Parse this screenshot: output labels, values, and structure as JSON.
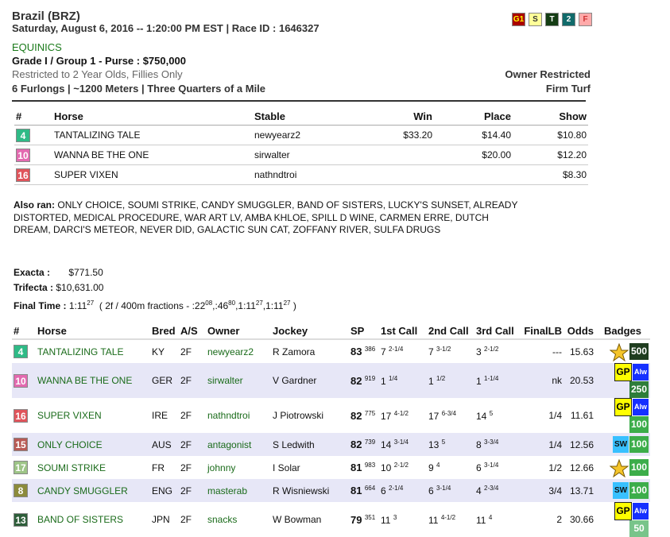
{
  "header": {
    "track": "Brazil (BRZ)",
    "date_line": "Saturday, August 6, 2016 -- 1:20:00 PM EST | Race ID : 1646327",
    "brand": "EQUINICS",
    "grade_purse": "Grade I / Group 1 - Purse : $750,000",
    "restriction": "Restricted to 2 Year Olds, Fillies Only",
    "distance": "6 Furlongs | ~1200 Meters | Three Quarters of a Mile",
    "owner_restricted": "Owner Restricted",
    "surface": "Firm Turf",
    "badges": [
      {
        "label": "G1",
        "cls": "tb-g1"
      },
      {
        "label": "S",
        "cls": "tb-s"
      },
      {
        "label": "T",
        "cls": "tb-t"
      },
      {
        "label": "2",
        "cls": "tb-2"
      },
      {
        "label": "F",
        "cls": "tb-f"
      }
    ]
  },
  "results": {
    "columns": [
      "#",
      "Horse",
      "Stable",
      "Win",
      "Place",
      "Show"
    ],
    "rows": [
      {
        "num": "4",
        "color": "#2fba86",
        "horse": "TANTALIZING TALE",
        "stable": "newyearz2",
        "win": "$33.20",
        "place": "$14.40",
        "show": "$10.80"
      },
      {
        "num": "10",
        "color": "#e36ab0",
        "horse": "WANNA BE THE ONE",
        "stable": "sirwalter",
        "win": "",
        "place": "$20.00",
        "show": "$12.20"
      },
      {
        "num": "16",
        "color": "#e0545b",
        "horse": "SUPER VIXEN",
        "stable": "nathndtroi",
        "win": "",
        "place": "",
        "show": "$8.30"
      }
    ]
  },
  "also_ran": {
    "label": "Also ran:",
    "text": "ONLY CHOICE, SOUMI STRIKE, CANDY SMUGGLER, BAND OF SISTERS, LUCKY'S SUNSET, ALREADY DISTORTED, MEDICAL PROCEDURE, WAR ART LV, AMBA KHLOE, SPILL D WINE, CARMEN ERRE, DUTCH DREAM, DARCI'S METEOR, NEVER DID, GALACTIC SUN CAT, ZOFFANY RIVER, SULFA DRUGS"
  },
  "exotics": {
    "exacta_label": "Exacta :",
    "exacta_value": "$771.50",
    "trifecta_label": "Trifecta :",
    "trifecta_value": "$10,631.00"
  },
  "final_time": {
    "label": "Final Time :",
    "time": "1:11",
    "time_sup": "27",
    "fractions_prefix": "( 2f / 400m fractions - :22",
    "f1_sup": "08",
    "f2": ",:46",
    "f2_sup": "80",
    "f3": ",1:11",
    "f3_sup": "27",
    "f4": ",1:11",
    "f4_sup": "27",
    "suffix": ")"
  },
  "field": {
    "columns": [
      "#",
      "Horse",
      "Bred",
      "A/S",
      "Owner",
      "Jockey",
      "SP",
      "1st Call",
      "2nd Call",
      "3rd Call",
      "FinalLB",
      "Odds",
      "Badges"
    ],
    "rows": [
      {
        "num": "4",
        "color": "#2fba86",
        "horse": "TANTALIZING TALE",
        "bred": "KY",
        "as": "2F",
        "owner": "newyearz2",
        "jockey": "R Zamora",
        "sp": "83",
        "sp_sup": "386",
        "c1": "7",
        "c1s": "2-1/4",
        "c2": "7",
        "c2s": "3-1/2",
        "c3": "3",
        "c3s": "2-1/2",
        "finallb": "---",
        "odds": "15.63",
        "badges": [
          {
            "type": "star",
            "name": "star-g1-icon"
          },
          {
            "type": "num",
            "label": "500",
            "color": "#1f3d1f"
          }
        ]
      },
      {
        "num": "10",
        "color": "#e36ab0",
        "horse": "WANNA BE THE ONE",
        "bred": "GER",
        "as": "2F",
        "owner": "sirwalter",
        "jockey": "V Gardner",
        "sp": "82",
        "sp_sup": "919",
        "c1": "1",
        "c1s": "1/4",
        "c2": "1",
        "c2s": "1/2",
        "c3": "1",
        "c3s": "1-1/4",
        "finallb": "nk",
        "odds": "20.53",
        "badges": [
          {
            "type": "gp",
            "label": "GP"
          },
          {
            "type": "alw",
            "label": "Alw"
          },
          {
            "type": "num",
            "label": "250",
            "color": "#2e7d3a"
          }
        ]
      },
      {
        "num": "16",
        "color": "#e0545b",
        "horse": "SUPER VIXEN",
        "bred": "IRE",
        "as": "2F",
        "owner": "nathndtroi",
        "jockey": "J Piotrowski",
        "sp": "82",
        "sp_sup": "775",
        "c1": "17",
        "c1s": "4-1/2",
        "c2": "17",
        "c2s": "6-3/4",
        "c3": "14",
        "c3s": "5",
        "finallb": "1/4",
        "odds": "11.61",
        "badges": [
          {
            "type": "gp",
            "label": "GP"
          },
          {
            "type": "alw",
            "label": "Alw"
          },
          {
            "type": "num",
            "label": "100",
            "color": "#3cad4a"
          }
        ]
      },
      {
        "num": "15",
        "color": "#b85a56",
        "horse": "ONLY CHOICE",
        "bred": "AUS",
        "as": "2F",
        "owner": "antagonist",
        "jockey": "S Ledwith",
        "sp": "82",
        "sp_sup": "739",
        "c1": "14",
        "c1s": "3-1/4",
        "c2": "13",
        "c2s": "5",
        "c3": "8",
        "c3s": "3-3/4",
        "finallb": "1/4",
        "odds": "12.56",
        "badges": [
          {
            "type": "sw",
            "label": "SW"
          },
          {
            "type": "num",
            "label": "100",
            "color": "#3cad4a"
          }
        ]
      },
      {
        "num": "17",
        "color": "#9dc487",
        "horse": "SOUMI STRIKE",
        "bred": "FR",
        "as": "2F",
        "owner": "johnny",
        "jockey": "I Solar",
        "sp": "81",
        "sp_sup": "983",
        "c1": "10",
        "c1s": "2-1/2",
        "c2": "9",
        "c2s": "4",
        "c3": "6",
        "c3s": "3-1/4",
        "finallb": "1/2",
        "odds": "12.66",
        "badges": [
          {
            "type": "star",
            "name": "star-g3-icon"
          },
          {
            "type": "num",
            "label": "100",
            "color": "#3cad4a"
          }
        ]
      },
      {
        "num": "8",
        "color": "#8c8b3c",
        "horse": "CANDY SMUGGLER",
        "bred": "ENG",
        "as": "2F",
        "owner": "masterab",
        "jockey": "R Wisniewski",
        "sp": "81",
        "sp_sup": "664",
        "c1": "6",
        "c1s": "2-1/4",
        "c2": "6",
        "c2s": "3-1/4",
        "c3": "4",
        "c3s": "2-3/4",
        "finallb": "3/4",
        "odds": "13.71",
        "badges": [
          {
            "type": "sw",
            "label": "SW"
          },
          {
            "type": "num",
            "label": "100",
            "color": "#3cad4a"
          }
        ]
      },
      {
        "num": "13",
        "color": "#2e5e3a",
        "horse": "BAND OF SISTERS",
        "bred": "JPN",
        "as": "2F",
        "owner": "snacks",
        "jockey": "W Bowman",
        "sp": "79",
        "sp_sup": "351",
        "c1": "11",
        "c1s": "3",
        "c2": "11",
        "c2s": "4-1/2",
        "c3": "11",
        "c3s": "4",
        "finallb": "2",
        "odds": "30.66",
        "badges": [
          {
            "type": "gp",
            "label": "GP"
          },
          {
            "type": "alw",
            "label": "Alw"
          },
          {
            "type": "num",
            "label": "50",
            "color": "#78c48a"
          }
        ]
      }
    ]
  }
}
